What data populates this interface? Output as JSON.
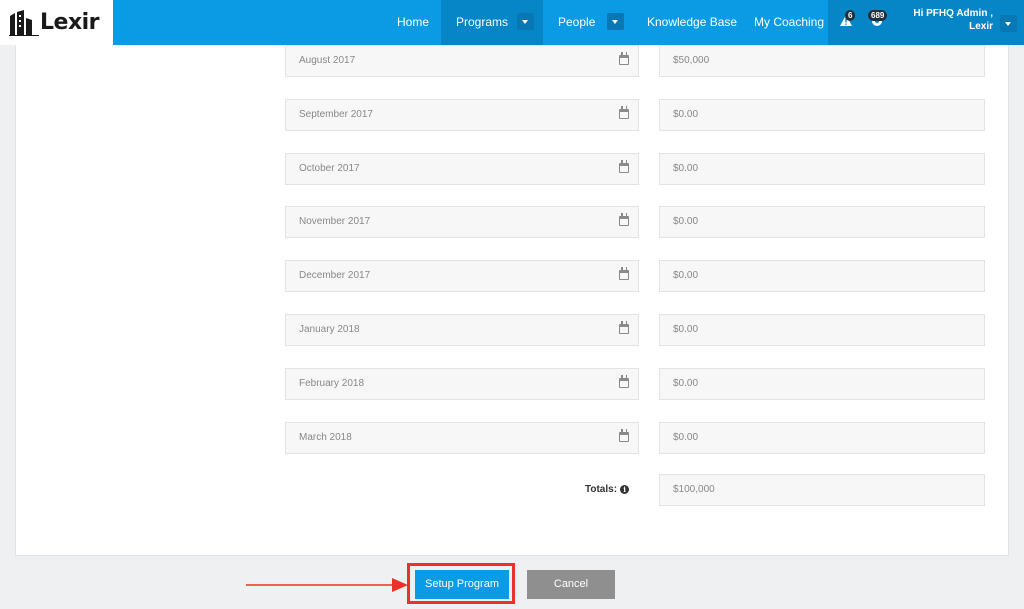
{
  "brand": {
    "name": "Lexir"
  },
  "nav": {
    "home": "Home",
    "programs": "Programs",
    "people": "People",
    "knowledge_base": "Knowledge Base",
    "my_coaching": "My Coaching",
    "alerts_count": "6",
    "notifications_count": "689",
    "greeting_line1": "Hi PFHQ Admin ,",
    "greeting_line2": "Lexir"
  },
  "months": [
    {
      "month": "August 2017",
      "amount": "$50,000"
    },
    {
      "month": "September 2017",
      "amount": "$0.00"
    },
    {
      "month": "October 2017",
      "amount": "$0.00"
    },
    {
      "month": "November 2017",
      "amount": "$0.00"
    },
    {
      "month": "December 2017",
      "amount": "$0.00"
    },
    {
      "month": "January 2018",
      "amount": "$0.00"
    },
    {
      "month": "February 2018",
      "amount": "$0.00"
    },
    {
      "month": "March 2018",
      "amount": "$0.00"
    }
  ],
  "totals": {
    "label": "Totals:",
    "value": "$100,000"
  },
  "actions": {
    "setup": "Setup Program",
    "cancel": "Cancel"
  },
  "colors": {
    "primary": "#0b9be5",
    "highlight": "#e8322a",
    "cancel": "#8f8f8f"
  }
}
